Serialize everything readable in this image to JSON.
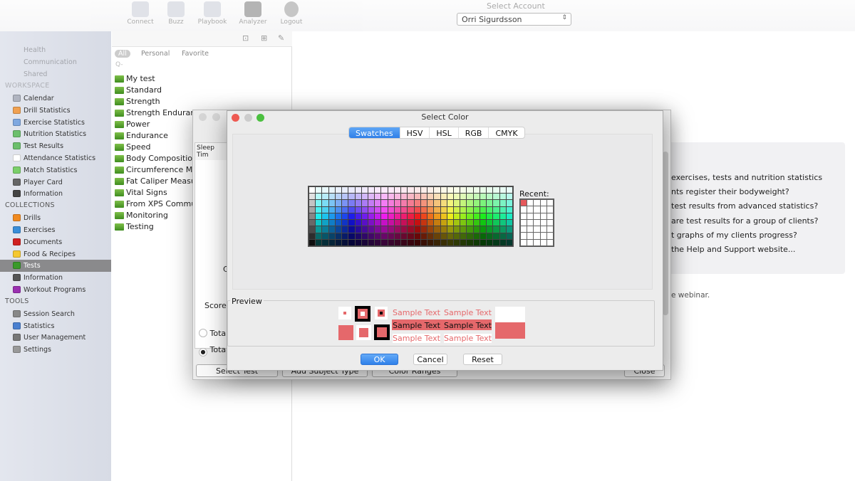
{
  "toolbar": {
    "items": [
      {
        "label": "Connect",
        "icon": "connect-icon"
      },
      {
        "label": "Buzz",
        "icon": "chat-bubble-icon"
      },
      {
        "label": "Playbook",
        "icon": "playbook-icon"
      },
      {
        "label": "Analyzer",
        "icon": "analyzer-icon"
      },
      {
        "label": "Logout",
        "icon": "power-icon"
      }
    ],
    "account_label": "Select Account",
    "account_value": "Orri Sigurdsson"
  },
  "sidebar": {
    "faded_items": [
      "Health",
      "Communication",
      "Shared"
    ],
    "workspace_header": "WORKSPACE",
    "workspace": [
      {
        "label": "Calendar",
        "color": "#b0b4c0"
      },
      {
        "label": "Drill Statistics",
        "color": "#f0a050"
      },
      {
        "label": "Exercise Statistics",
        "color": "#7fa8e0"
      },
      {
        "label": "Nutrition Statistics",
        "color": "#6cbf6c"
      },
      {
        "label": "Test Results",
        "color": "#6cbf6c"
      },
      {
        "label": "Attendance Statistics",
        "color": "#ffffff"
      },
      {
        "label": "Match Statistics",
        "color": "#7bcf6a"
      },
      {
        "label": "Player Card",
        "color": "#666666"
      },
      {
        "label": "Information",
        "color": "#444444"
      }
    ],
    "collections_header": "COLLECTIONS",
    "collections": [
      {
        "label": "Drills",
        "color": "#f08a20"
      },
      {
        "label": "Exercises",
        "color": "#3a8ed8"
      },
      {
        "label": "Documents",
        "color": "#d02020"
      },
      {
        "label": "Food & Recipes",
        "color": "#f5c830"
      },
      {
        "label": "Tests",
        "color": "#3a9a2a",
        "selected": true
      },
      {
        "label": "Information",
        "color": "#555555"
      },
      {
        "label": "Workout Programs",
        "color": "#9a30b0"
      }
    ],
    "tools_header": "TOOLS",
    "tools": [
      {
        "label": "Session Search",
        "color": "#888888"
      },
      {
        "label": "Statistics",
        "color": "#4a80d0"
      },
      {
        "label": "User Management",
        "color": "#777777"
      },
      {
        "label": "Settings",
        "color": "#999999"
      }
    ]
  },
  "middle": {
    "tabs": [
      "All",
      "Personal",
      "Favorite"
    ],
    "search_placeholder": "Q-",
    "folders": [
      "My test",
      "Standard",
      "Strength",
      "Strength Endurance",
      "Power",
      "Endurance",
      "Speed",
      "Body Composition",
      "Circumference Me",
      "Fat Caliper Measu",
      "Vital Signs",
      "From XPS Commu",
      "Monitoring",
      "Testing"
    ]
  },
  "back_dialog": {
    "column_header": "Sleep Tim",
    "partial_label": "C",
    "score_label": "Score",
    "radio1": "Tota",
    "radio2": "Tota",
    "radio2_selected": true,
    "buttons": [
      "Select Test",
      "Add Subject Type",
      "Color Ranges",
      "Close"
    ]
  },
  "right_panel": {
    "lines": [
      "exercises, tests and nutrition statistics",
      "nts register their bodyweight?",
      "test results from advanced statistics?",
      "are test results for a group of clients?",
      "t graphs of my clients progress?",
      "the Help and Support website..."
    ],
    "footer": "e webinar."
  },
  "color_dialog": {
    "title": "Select Color",
    "tabs": [
      "Swatches",
      "HSV",
      "HSL",
      "RGB",
      "CMYK"
    ],
    "active_tab": "Swatches",
    "recent_label": "Recent:",
    "recent_colors": [
      "#e5585b"
    ],
    "preview_label": "Preview",
    "sample_text": "Sample Text",
    "selected_color": "#e5686b",
    "buttons": {
      "ok": "OK",
      "cancel": "Cancel",
      "reset": "Reset"
    }
  }
}
